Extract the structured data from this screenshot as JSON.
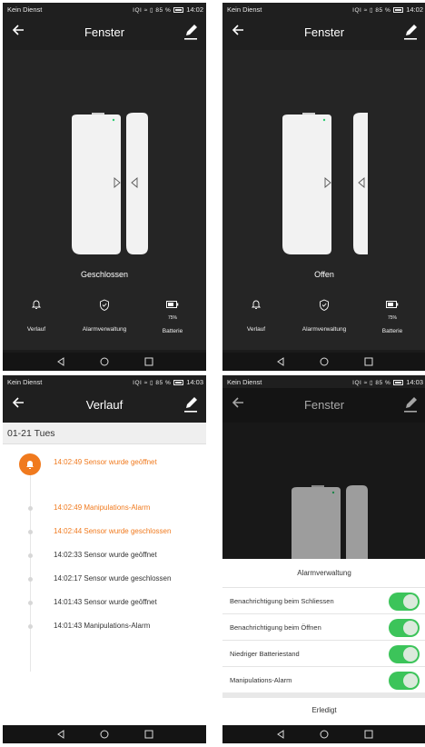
{
  "status": {
    "carrier": "Kein Dienst",
    "icons": "IQI ≈ ▯ 85 %",
    "time_a": "14:02",
    "time_b": "14:03"
  },
  "device": {
    "title": "Fenster",
    "state_closed": "Geschlossen",
    "state_open": "Offen",
    "tools": {
      "history": "Verlauf",
      "alarm": "Alarmverwaltung",
      "battery": "Batterie",
      "battery_pct": "75%"
    }
  },
  "history": {
    "title": "Verlauf",
    "date": "01-21 Tues",
    "events": [
      {
        "text": "14:02:49 Sensor wurde geöffnet",
        "highlight": true
      },
      {
        "text": "14:02:49 Manipulations-Alarm",
        "highlight": true
      },
      {
        "text": "14:02:44 Sensor wurde geschlossen",
        "highlight": true
      },
      {
        "text": "14:02:33 Sensor wurde geöffnet",
        "highlight": false
      },
      {
        "text": "14:02:17 Sensor wurde geschlossen",
        "highlight": false
      },
      {
        "text": "14:01:43 Sensor wurde geöffnet",
        "highlight": false
      },
      {
        "text": "14:01:43 Manipulations-Alarm",
        "highlight": false
      }
    ]
  },
  "alarm": {
    "heading": "Alarmverwaltung",
    "rows": [
      {
        "label": "Benachrichtigung beim Schliessen",
        "on": true
      },
      {
        "label": "Benachrichtigung beim Öffnen",
        "on": true
      },
      {
        "label": "Niedriger Batteriestand",
        "on": true
      },
      {
        "label": "Manipulations-Alarm",
        "on": true
      }
    ],
    "done": "Erledigt"
  },
  "colors": {
    "accent": "#f07a1e",
    "toggle_on": "#3cc45a",
    "app_bg": "#1f1f1f",
    "led": "#2ecc71"
  },
  "icons": [
    "back-arrow-icon",
    "edit-pencil-icon",
    "bell-icon",
    "shield-check-icon",
    "battery-icon",
    "nav-back-icon",
    "nav-home-icon",
    "nav-recents-icon"
  ]
}
